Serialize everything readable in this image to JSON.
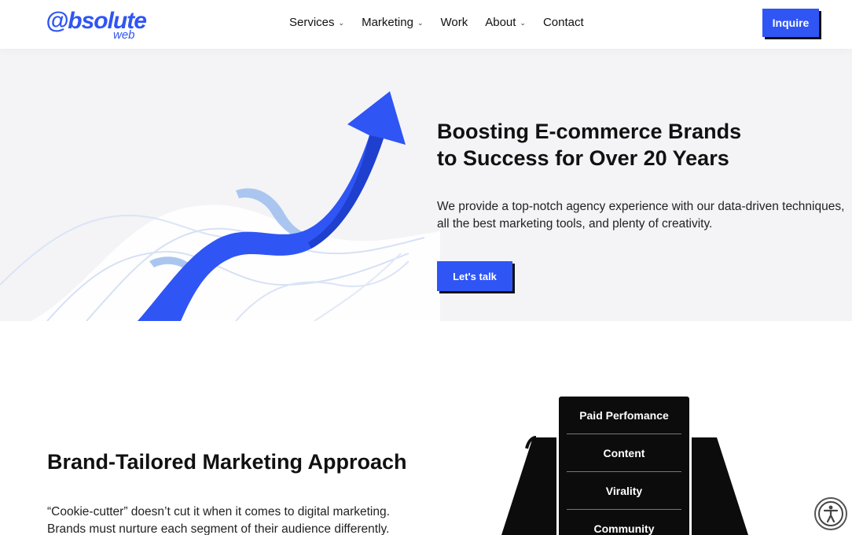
{
  "header": {
    "logo_main": "@bsolute",
    "logo_sub": "web",
    "nav": [
      {
        "label": "Services",
        "has_dropdown": true
      },
      {
        "label": "Marketing",
        "has_dropdown": true
      },
      {
        "label": "Work",
        "has_dropdown": false
      },
      {
        "label": "About",
        "has_dropdown": true
      },
      {
        "label": "Contact",
        "has_dropdown": false
      }
    ],
    "inquire_label": "Inquire"
  },
  "hero": {
    "title_line1": "Boosting E-commerce Brands",
    "title_line2": "to Success for Over 20 Years",
    "description": "We provide a top-notch agency experience with our data-driven techniques, all the best marketing tools, and plenty of creativity.",
    "cta_label": "Let's talk"
  },
  "section2": {
    "title": "Brand-Tailored Marketing Approach",
    "description": "“Cookie-cutter” doesn’t cut it when it comes to digital marketing. Brands must nurture each segment of their audience differently.",
    "podium_items": [
      "Paid Perfomance",
      "Content",
      "Virality",
      "Community"
    ]
  },
  "colors": {
    "accent": "#2f55f5",
    "hero_bg": "#f4f4f6",
    "dark": "#111111"
  },
  "icons": {
    "accessibility": "accessibility-icon",
    "dropdown": "chevron-down-icon"
  }
}
